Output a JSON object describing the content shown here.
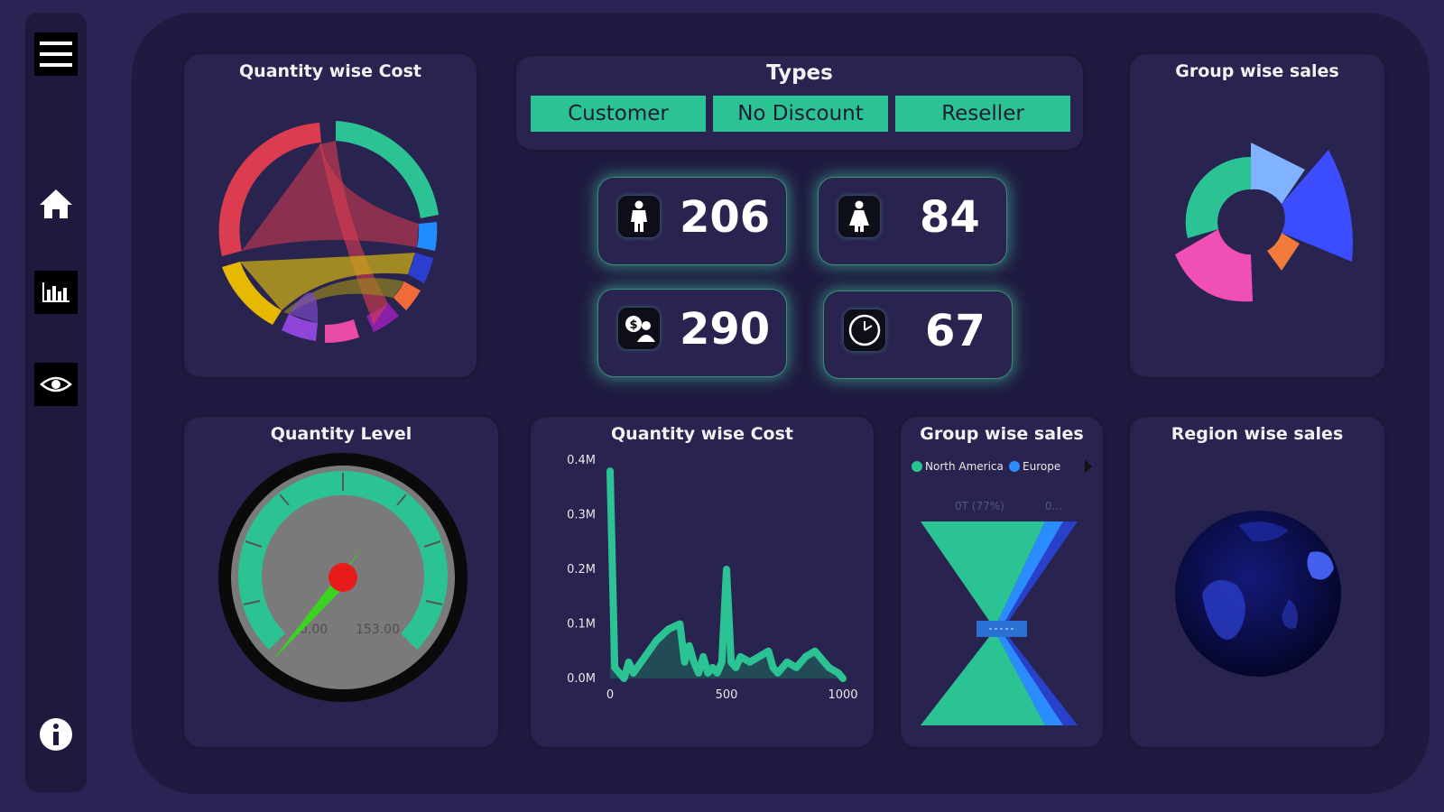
{
  "sidebar": {
    "icons": [
      "menu-icon",
      "home-icon",
      "bar-chart-icon",
      "eye-icon",
      "info-icon"
    ]
  },
  "types": {
    "title": "Types",
    "buttons": [
      "Customer",
      "No Discount",
      "Reseller"
    ]
  },
  "kpis": [
    {
      "icon": "male-person-icon",
      "value": "206"
    },
    {
      "icon": "female-person-icon",
      "value": "84"
    },
    {
      "icon": "money-person-icon",
      "value": "290"
    },
    {
      "icon": "clock-icon",
      "value": "67"
    }
  ],
  "cards": {
    "chord_title": "Quantity wise Cost",
    "sunburst_title": "Group wise sales",
    "gauge_title": "Quantity Level",
    "area_title": "Quantity wise Cost",
    "funnel_title": "Group wise sales",
    "globe_title": "Region wise sales"
  },
  "gauge": {
    "min_label": "0.00",
    "max_label": "153.00",
    "accent": "#2cc394"
  },
  "funnel": {
    "legend": [
      "North America",
      "Europe"
    ],
    "label_1": "0T (77%)",
    "label_2": "0..."
  },
  "colors": {
    "accent": "#2cc394",
    "background": "#1f1b40",
    "card": "#28234f",
    "blue": "#2b6bff"
  },
  "chart_data": {
    "type": "area",
    "title": "Quantity wise Cost",
    "x": [
      0,
      20,
      40,
      60,
      80,
      100,
      150,
      200,
      250,
      300,
      320,
      340,
      360,
      380,
      400,
      420,
      440,
      460,
      480,
      500,
      520,
      540,
      560,
      600,
      640,
      680,
      700,
      720,
      760,
      800,
      840,
      880,
      920,
      940,
      980,
      1000
    ],
    "values": [
      0.38,
      0.02,
      0.01,
      0.0,
      0.03,
      0.01,
      0.04,
      0.07,
      0.09,
      0.1,
      0.03,
      0.06,
      0.03,
      0.01,
      0.04,
      0.01,
      0.02,
      0.01,
      0.03,
      0.2,
      0.03,
      0.02,
      0.04,
      0.03,
      0.04,
      0.05,
      0.02,
      0.01,
      0.03,
      0.02,
      0.04,
      0.05,
      0.03,
      0.02,
      0.01,
      0.0
    ],
    "xlim": [
      0,
      1000
    ],
    "ylim": [
      0,
      0.4
    ],
    "y_ticks": [
      "0.0M",
      "0.1M",
      "0.2M",
      "0.3M",
      "0.4M"
    ],
    "x_ticks": [
      "0",
      "500",
      "1000"
    ]
  }
}
